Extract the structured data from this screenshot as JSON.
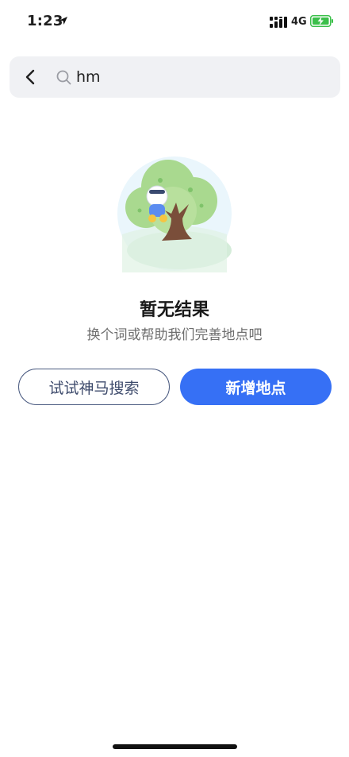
{
  "status_bar": {
    "time": "1:23",
    "network": "4G"
  },
  "search": {
    "query": "hm",
    "placeholder": ""
  },
  "empty_state": {
    "title": "暂无结果",
    "subtitle": "换个词或帮助我们完善地点吧"
  },
  "actions": {
    "secondary_label": "试试神马搜索",
    "primary_label": "新增地点"
  },
  "colors": {
    "primary": "#3670f5",
    "outline": "#4a5a80",
    "search_bg": "#f0f1f4"
  },
  "icons": [
    "location-arrow-icon",
    "signal-icon",
    "battery-charging-icon",
    "back-chevron-icon",
    "search-icon",
    "empty-tree-illustration"
  ]
}
